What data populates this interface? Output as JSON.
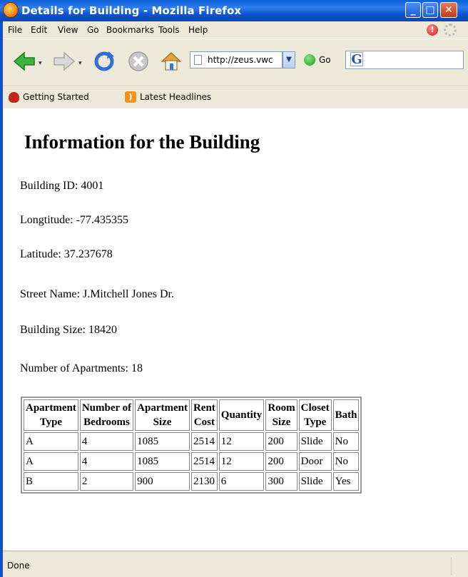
{
  "window": {
    "title": "Details for Building - Mozilla Firefox"
  },
  "menu": {
    "items": [
      "File",
      "Edit",
      "View",
      "Go",
      "Bookmarks",
      "Tools",
      "Help"
    ]
  },
  "nav": {
    "url": "http://zeus.vwc.e",
    "go_label": "Go"
  },
  "bookmarks": {
    "items": [
      "Getting Started",
      "Latest Headlines"
    ]
  },
  "page": {
    "heading": "Information for the Building",
    "fields": [
      {
        "label": "Building ID:",
        "value": "4001"
      },
      {
        "label": "Longtitude:",
        "value": "-77.435355"
      },
      {
        "label": "Latitude:",
        "value": "37.237678"
      },
      {
        "label": "Street Name:",
        "value": "J.Mitchell Jones Dr."
      },
      {
        "label": "Building Size:",
        "value": "18420"
      },
      {
        "label": "Number of Apartments:",
        "value": "18"
      }
    ],
    "table": {
      "headers": [
        [
          "Apartment",
          "Type"
        ],
        [
          "Number of",
          "Bedrooms"
        ],
        [
          "Apartment",
          "Size"
        ],
        [
          "Rent",
          "Cost"
        ],
        [
          "Quantity"
        ],
        [
          "Room",
          "Size"
        ],
        [
          "Closet",
          "Type"
        ],
        [
          "Bath"
        ]
      ],
      "rows": [
        [
          "A",
          "4",
          "1085",
          "2514",
          "12",
          "200",
          "Slide",
          "No"
        ],
        [
          "A",
          "4",
          "1085",
          "2514",
          "12",
          "200",
          "Door",
          "No"
        ],
        [
          "B",
          "2",
          "900",
          "2130",
          "6",
          "300",
          "Slide",
          "Yes"
        ]
      ]
    }
  },
  "status": {
    "text": "Done"
  },
  "icons": {
    "app": "firefox-icon",
    "back": "back-arrow-icon",
    "forward": "forward-arrow-icon",
    "reload": "reload-icon",
    "stop": "stop-icon",
    "home": "home-icon",
    "go": "go-icon",
    "search_engine": "google-icon"
  }
}
